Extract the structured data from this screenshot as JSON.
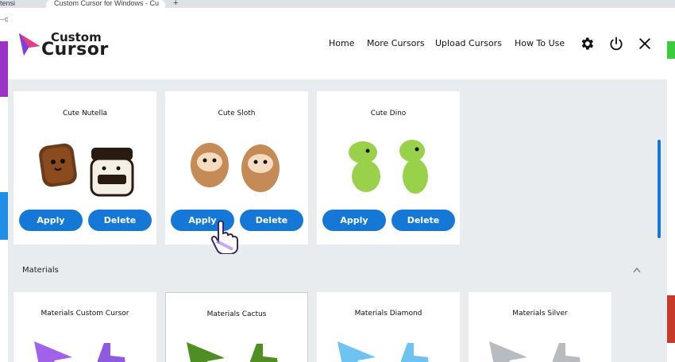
{
  "browser": {
    "tab_left": "tensi",
    "tab_active": "Custom Cursor for Windows - Cu",
    "new_tab": "+",
    "url_left": "--c"
  },
  "header": {
    "logo_top": "Custom",
    "logo_bottom": "Cursor",
    "nav": [
      "Home",
      "More Cursors",
      "Upload Cursors",
      "How To Use"
    ],
    "icons": [
      "gear-icon",
      "power-icon",
      "close-icon"
    ]
  },
  "packs": [
    {
      "title": "Cute Nutella",
      "apply_label": "Apply",
      "delete_label": "Delete"
    },
    {
      "title": "Cute Sloth",
      "apply_label": "Apply",
      "delete_label": "Delete"
    },
    {
      "title": "Cute Dino",
      "apply_label": "Apply",
      "delete_label": "Delete"
    }
  ],
  "section": {
    "title": "Materials"
  },
  "materials": [
    {
      "title": "Materials Custom Cursor"
    },
    {
      "title": "Materials Cactus"
    },
    {
      "title": "Materials Diamond"
    },
    {
      "title": "Materials Silver"
    }
  ],
  "colors": {
    "accent": "#1577d6",
    "background": "#e8ecef",
    "card": "#ffffff"
  }
}
